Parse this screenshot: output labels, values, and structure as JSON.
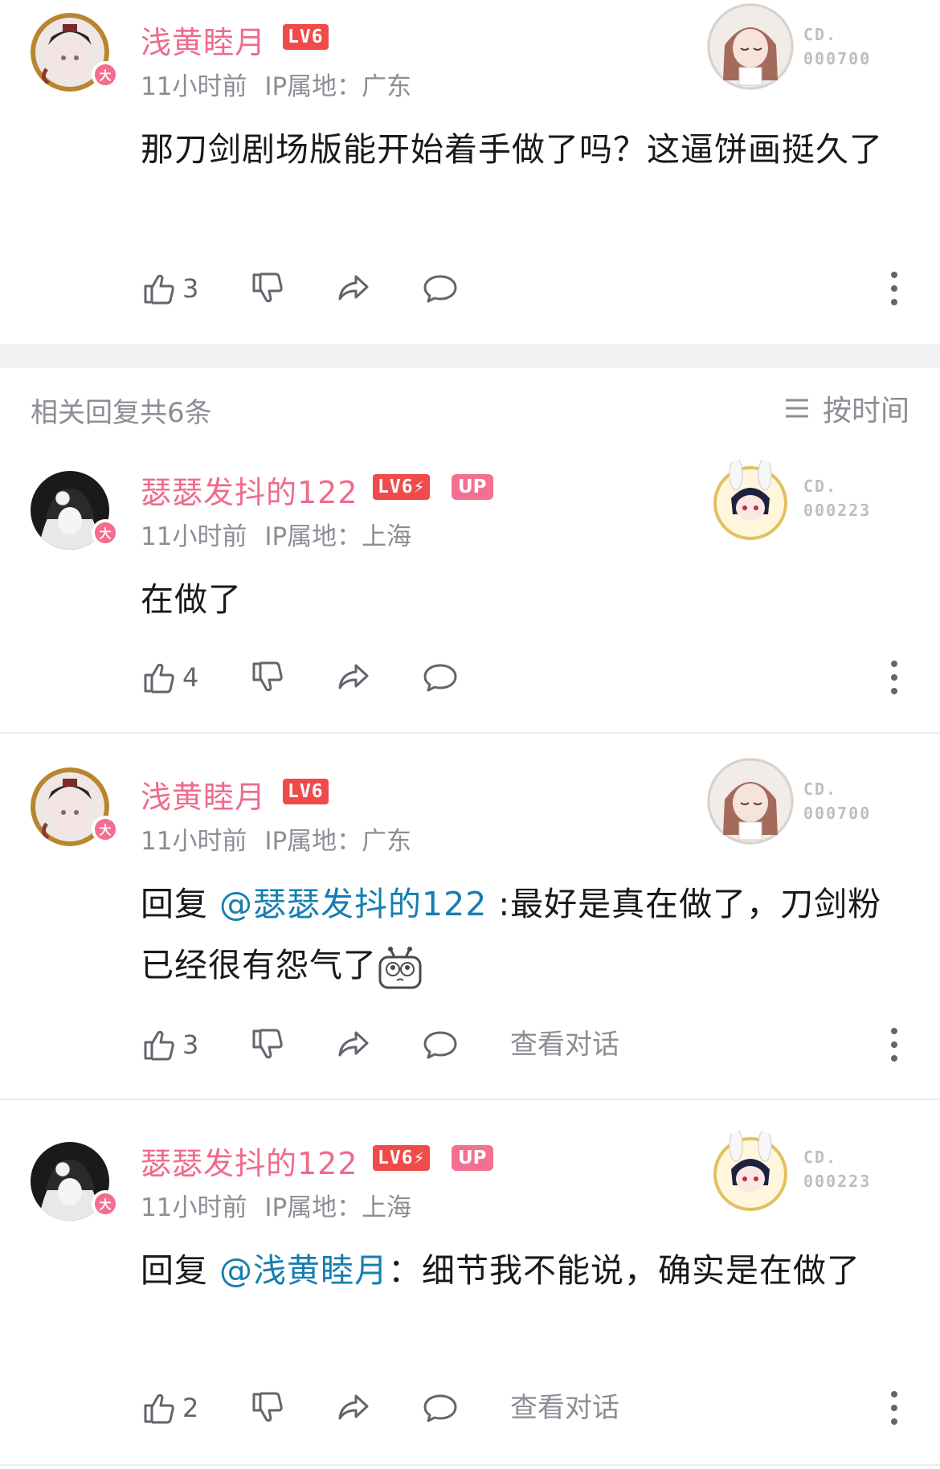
{
  "comments": [
    {
      "username": "浅黄睦月",
      "level": "LV6",
      "time": "11小时前",
      "ip": "IP属地：广东",
      "text": "那刀剑剧场版能开始着手做了吗？这逼饼画挺久了",
      "likes": "3",
      "deco_no": [
        "CD.",
        "000700"
      ]
    },
    {
      "username": "瑟瑟发抖的122",
      "level": "LV6",
      "up_badge": "UP",
      "time": "11小时前",
      "ip": "IP属地：上海",
      "text": "在做了",
      "likes": "4",
      "deco_no": [
        "CD.",
        "000223"
      ]
    },
    {
      "username": "浅黄睦月",
      "level": "LV6",
      "time": "11小时前",
      "ip": "IP属地：广东",
      "reply_prefix": "回复 ",
      "reply_at": "@瑟瑟发抖的122",
      "text": " :最好是真在做了，刀剑粉已经很有怨气了",
      "likes": "3",
      "view_conversation": "查看对话",
      "deco_no": [
        "CD.",
        "000700"
      ]
    },
    {
      "username": "瑟瑟发抖的122",
      "level": "LV6",
      "up_badge": "UP",
      "time": "11小时前",
      "ip": "IP属地：上海",
      "reply_prefix": "回复 ",
      "reply_at": "@浅黄睦月",
      "text": "：细节我不能说，确实是在做了",
      "likes": "2",
      "view_conversation": "查看对话",
      "deco_no": [
        "CD.",
        "000223"
      ]
    }
  ],
  "replies_header": "相关回复共6条",
  "sort_label": "按时间",
  "avatar_badge": "大",
  "icons": [
    "like-icon",
    "dislike-icon",
    "share-icon",
    "reply-icon",
    "more-icon",
    "sort-icon"
  ],
  "colors": {
    "username": "#ef6b8c",
    "level_badge": "#f04b4b",
    "up_badge": "#f27090",
    "mention": "#167eb1",
    "meta": "#8b8e94"
  }
}
